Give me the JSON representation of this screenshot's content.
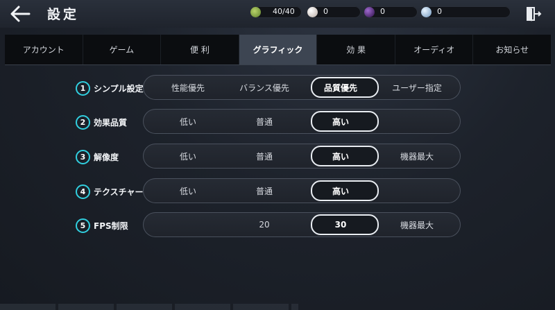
{
  "header": {
    "title": "設定",
    "resources": [
      {
        "icon": "stamina-icon",
        "value": "40/40",
        "color": "#7ea34a"
      },
      {
        "icon": "pearl-icon",
        "value": "0",
        "color": "#e8e0da"
      },
      {
        "icon": "dark-orb-icon",
        "value": "0",
        "color": "#5a2a8a"
      },
      {
        "icon": "silver-coin-icon",
        "value": "0",
        "color": "#a9c8e6"
      }
    ]
  },
  "tabs": [
    {
      "label": "アカウント",
      "active": false
    },
    {
      "label": "ゲーム",
      "active": false
    },
    {
      "label": "便 利",
      "active": false
    },
    {
      "label": "グラフィック",
      "active": true
    },
    {
      "label": "効 果",
      "active": false
    },
    {
      "label": "オーディオ",
      "active": false
    },
    {
      "label": "お知らせ",
      "active": false
    }
  ],
  "settings": [
    {
      "num": "1",
      "label": "シンプル設定",
      "options": [
        "性能優先",
        "バランス優先",
        "品質優先",
        "ユーザー指定"
      ],
      "selected": "品質優先"
    },
    {
      "num": "2",
      "label": "効果品質",
      "options": [
        "低い",
        "普通",
        "高い",
        ""
      ],
      "selected": "高い"
    },
    {
      "num": "3",
      "label": "解像度",
      "options": [
        "低い",
        "普通",
        "高い",
        "機器最大"
      ],
      "selected": "高い"
    },
    {
      "num": "4",
      "label": "テクスチャー",
      "options": [
        "低い",
        "普通",
        "高い",
        ""
      ],
      "selected": "高い"
    },
    {
      "num": "5",
      "label": "FPS制限",
      "options": [
        "",
        "20",
        "30",
        "機器最大"
      ],
      "selected": "30"
    }
  ],
  "colors": {
    "accent": "#31d0e0",
    "active_tab": "#3d4552",
    "selected_border": "#e9edf2"
  }
}
